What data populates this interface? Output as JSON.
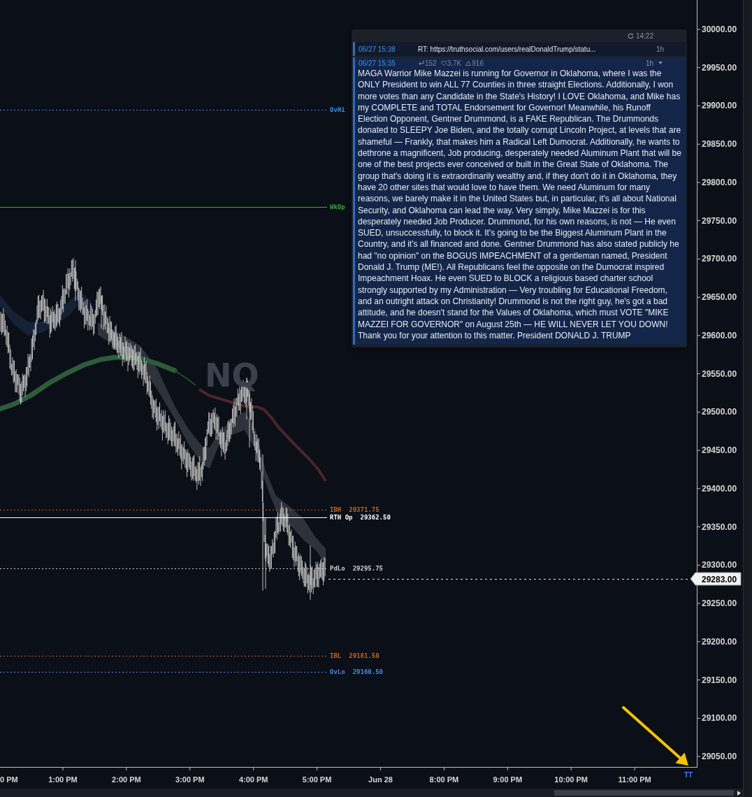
{
  "post_panel": {
    "refresh_time": "14:22",
    "posts": [
      {
        "time": "06/27 15:38",
        "text": "RT: https://truthsocial.com/users/realDonaldTrump/statu...",
        "age": "1h",
        "expanded": false
      },
      {
        "time": "06/27 15:35",
        "stats": [
          {
            "kind": "return",
            "value": "152"
          },
          {
            "kind": "heart",
            "value": "3.7K"
          },
          {
            "kind": "triangle",
            "value": "916"
          }
        ],
        "age": "1h",
        "expanded": true,
        "text": "MAGA Warrior Mike Mazzei is running for Governor in Oklahoma, where I was the ONLY President to win ALL 77 Counties in three straight Elections. Additionally, I won more votes than any Candidate in the State's History! I LOVE Oklahoma, and Mike has my COMPLETE and TOTAL Endorsement for Governor! Meanwhile, his Runoff Election Opponent, Gentner Drummond, is a FAKE Republican. The Drummonds donated to SLEEPY Joe Biden, and the totally corrupt Lincoln Project, at levels that are shameful — Frankly, that makes him a Radical Left Dumocrat. Additionally, he wants to dethrone a magnificent, Job producing, desperately needed Aluminum Plant that will be one of the best projects ever conceived or built in the Great State of Oklahoma. The group that's doing it is extraordinarily wealthy and, if they don't do it in Oklahoma, they have 20 other sites that would love to have them. We need Aluminum for many reasons, we barely make it in the United States but, in particular, it's all about National Security, and Oklahoma can lead the way. Very simply, Mike Mazzei is for this desperately needed Job Producer. Drummond, for his own reasons, is not — He even SUED, unsuccessfully, to block it. It's going to be the Biggest Aluminum Plant in the Country, and it's all financed and done. Gentner Drummond has also stated publicly he had \"no opinion\" on the BOGUS IMPEACHMENT of a gentleman named, President Donald J. Trump (ME!). All Republicans feel the opposite on the Dumocrat inspired Impeachment Hoax. He even SUED to BLOCK a religious based charter school strongly supported by my Administration — Very troubling for Educational Freedom, and an outright attack on Christianity! Drummond is not the right guy, he's got a bad attitude, and he doesn't stand for the Values of Oklahoma, which must VOTE \"MIKE MAZZEI FOR GOVERNOR\" on August 25th — HE WILL NEVER LET YOU DOWN! Thank you for your attention to this matter. President DONALD J. TRUMP"
      }
    ]
  },
  "chart": {
    "symbol": "NQ",
    "levels": [
      {
        "label": "OvHi",
        "kind": "dotted",
        "color": "#3b8ff0"
      },
      {
        "label": "WkOp",
        "kind": "solid",
        "color": "#3aa53a"
      },
      {
        "label": "IBH",
        "value": "29371.75",
        "kind": "dotted",
        "color": "#c2681e"
      },
      {
        "label": "RTH Op",
        "value": "29362.50",
        "kind": "solid",
        "color": "#ffffff"
      },
      {
        "label": "PdLo",
        "value": "29295.75",
        "kind": "dotted",
        "color": "#cfcfcf"
      },
      {
        "label": "IBL",
        "value": "29181.50",
        "kind": "dotted",
        "color": "#c2681e"
      },
      {
        "label": "OvLo",
        "value": "29160.50",
        "kind": "dotted",
        "color": "#3b8ff0"
      }
    ],
    "last_price": "29283.00",
    "price_axis": [
      "30000.00",
      "29950.00",
      "29900.00",
      "29850.00",
      "29800.00",
      "29750.00",
      "29700.00",
      "29650.00",
      "29600.00",
      "29550.00",
      "29500.00",
      "29450.00",
      "29400.00",
      "29350.00",
      "29300.00",
      "29250.00",
      "29200.00",
      "29150.00",
      "29100.00",
      "29050.00"
    ],
    "time_axis": [
      "0 PM",
      "1:00 PM",
      "2:00 PM",
      "3:00 PM",
      "4:00 PM",
      "5:00 PM",
      "Jun 28",
      "8:00 PM",
      "9:00 PM",
      "10:00 PM",
      "11:00 PM"
    ],
    "corner_label": "TT"
  }
}
